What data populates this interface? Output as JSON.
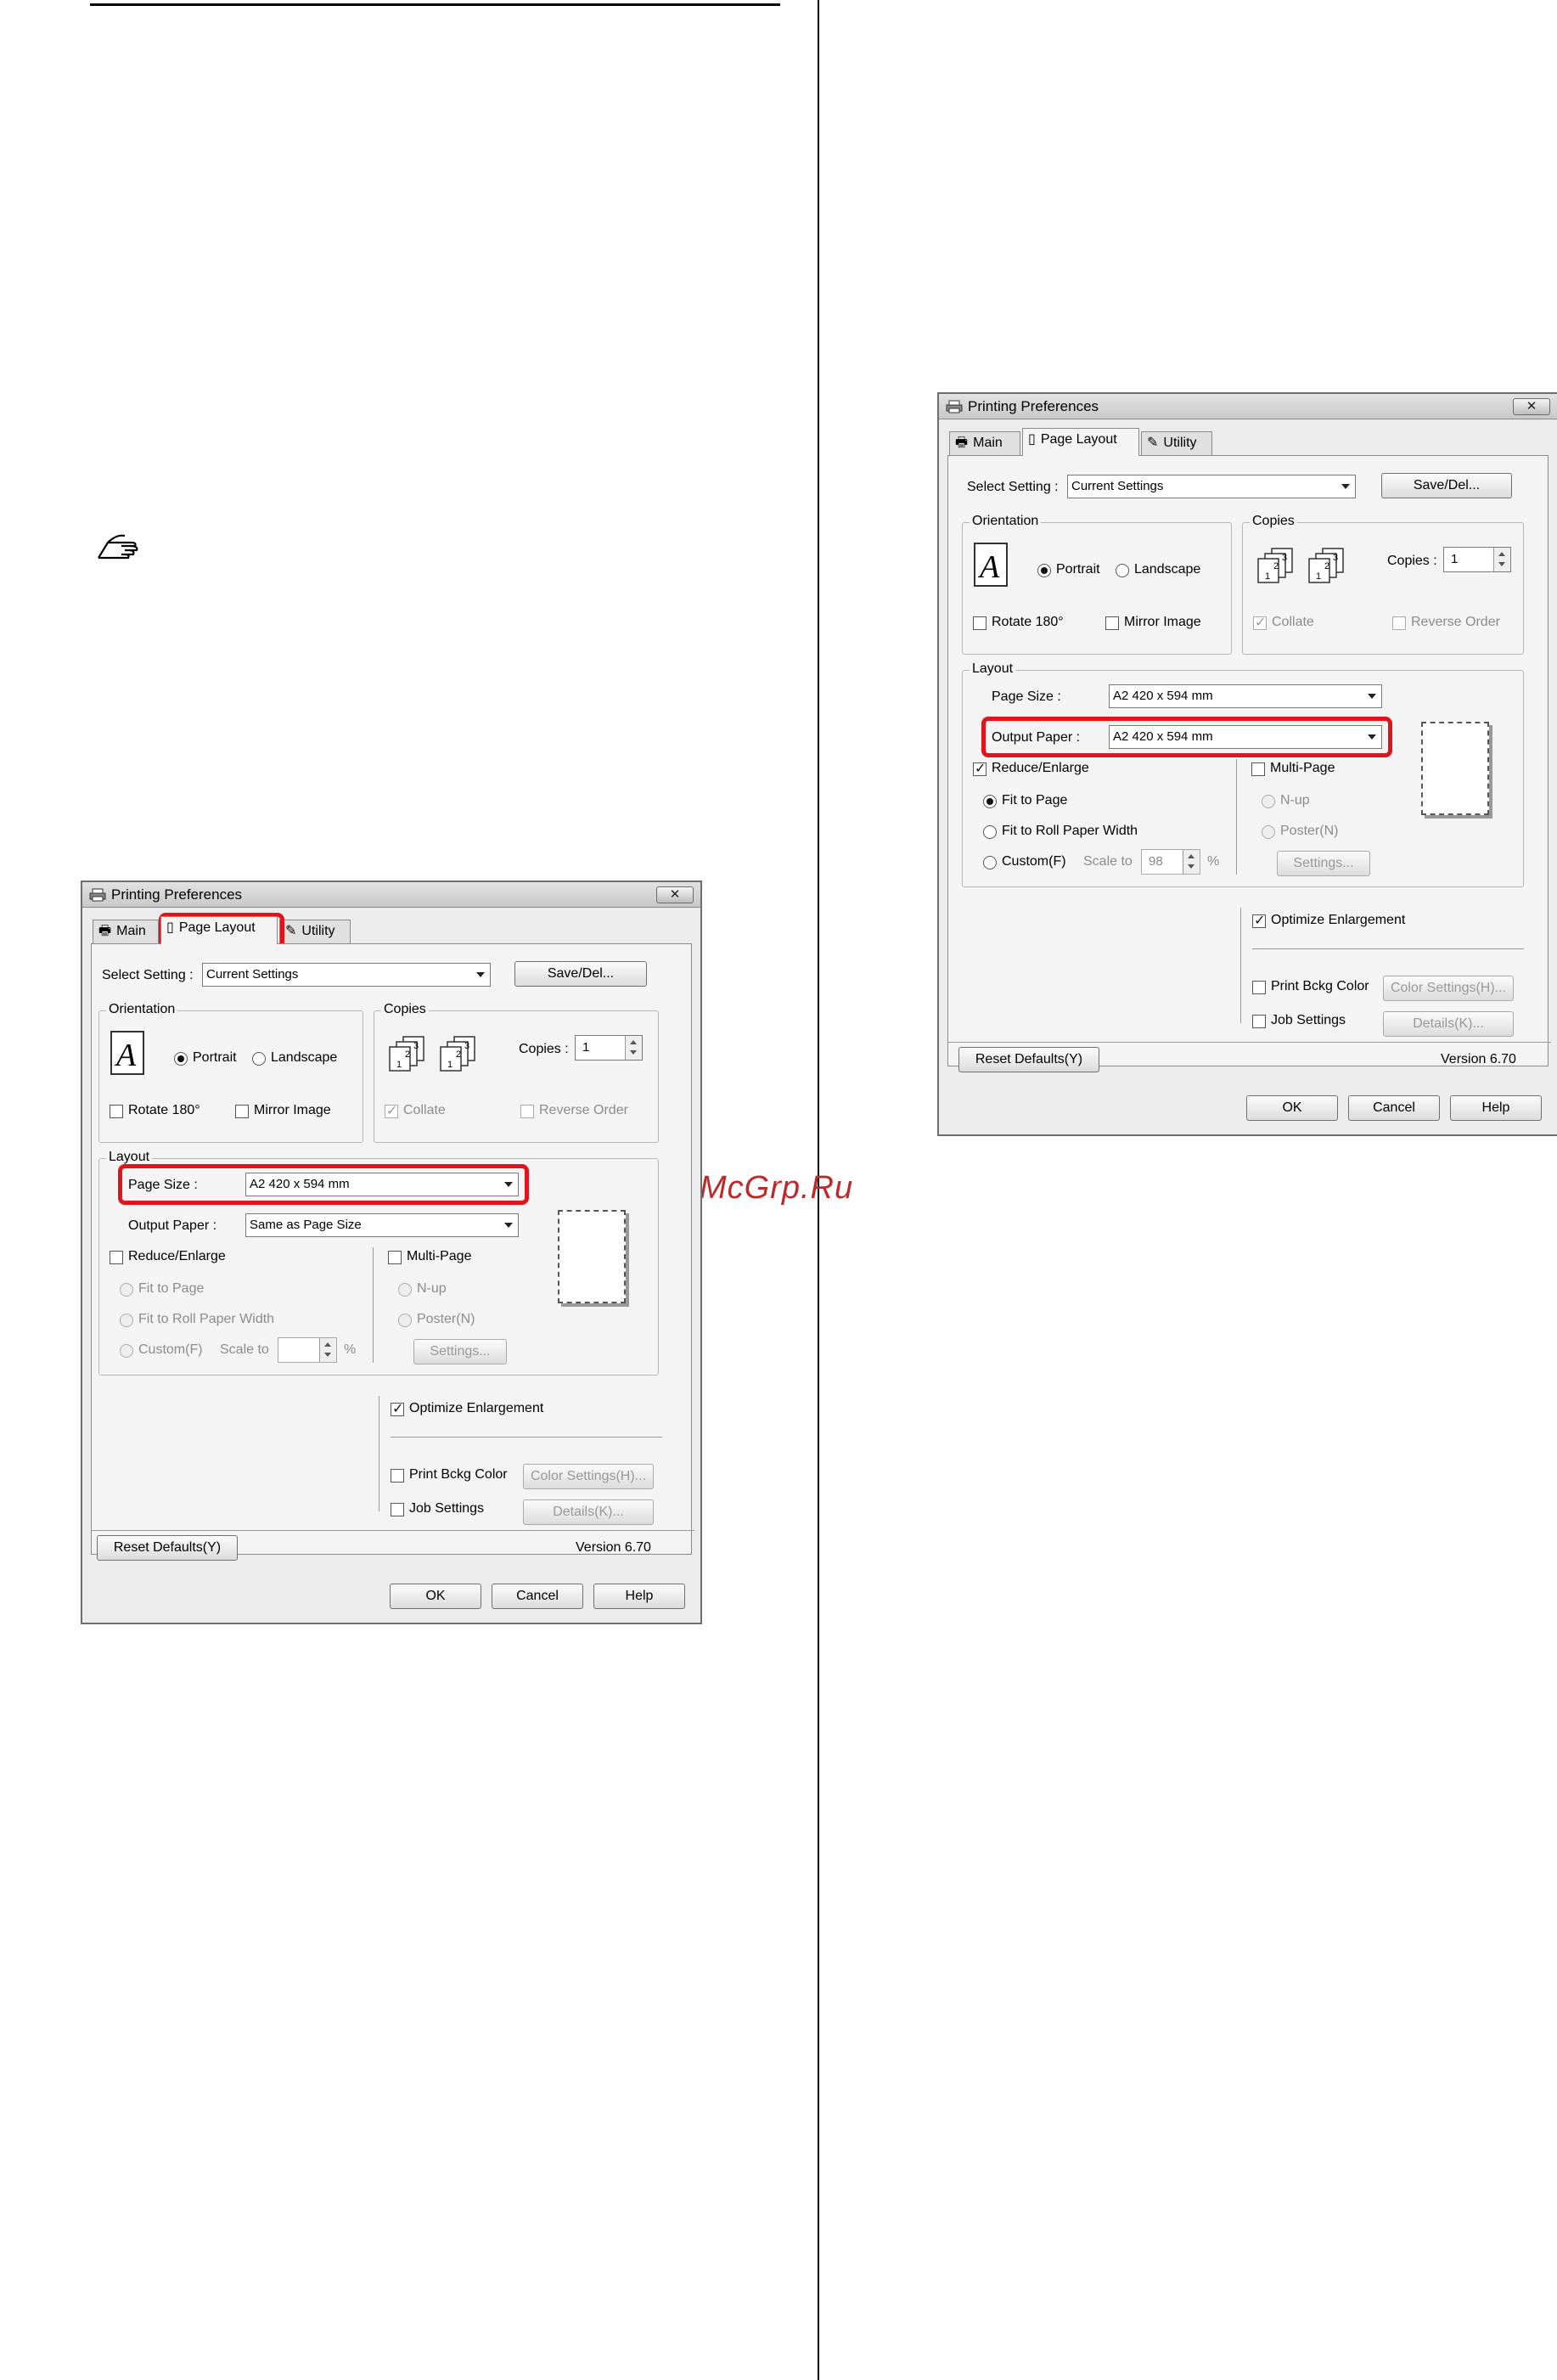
{
  "dialogs": [
    {
      "title": "Printing Preferences",
      "close": "✕",
      "tabs": [
        "Main",
        "Page Layout",
        "Utility"
      ],
      "select_setting_label": "Select Setting :",
      "select_setting_value": "Current Settings",
      "save_del": "Save/Del...",
      "orientation_title": "Orientation",
      "portrait": "Portrait",
      "landscape": "Landscape",
      "rotate": "Rotate 180°",
      "mirror": "Mirror Image",
      "copies_title": "Copies",
      "copies_label": "Copies :",
      "copies_value": "1",
      "collate": "Collate",
      "reverse": "Reverse Order",
      "layout_title": "Layout",
      "page_size_label": "Page Size :",
      "page_size_value": "A2 420 x 594 mm",
      "output_paper_label": "Output Paper :",
      "output_paper_value": "Same as Page Size",
      "reduce_enlarge": "Reduce/Enlarge",
      "fit_to_page": "Fit to Page",
      "fit_roll": "Fit to Roll Paper Width",
      "custom": "Custom(F)",
      "scale_to": "Scale to",
      "scale_value": "",
      "percent": "%",
      "multi_page": "Multi-Page",
      "n_up": "N-up",
      "poster": "Poster(N)",
      "settings": "Settings...",
      "optimize": "Optimize Enlargement",
      "print_bckg": "Print Bckg Color",
      "color_settings": "Color Settings(H)...",
      "job_settings": "Job Settings",
      "details": "Details(K)...",
      "reset": "Reset Defaults(Y)",
      "version": "Version 6.70",
      "ok": "OK",
      "cancel": "Cancel",
      "help": "Help"
    },
    {
      "title": "Printing Preferences",
      "close": "✕",
      "tabs": [
        "Main",
        "Page Layout",
        "Utility"
      ],
      "select_setting_label": "Select Setting :",
      "select_setting_value": "Current Settings",
      "save_del": "Save/Del...",
      "orientation_title": "Orientation",
      "portrait": "Portrait",
      "landscape": "Landscape",
      "rotate": "Rotate 180°",
      "mirror": "Mirror Image",
      "copies_title": "Copies",
      "copies_label": "Copies :",
      "copies_value": "1",
      "collate": "Collate",
      "reverse": "Reverse Order",
      "layout_title": "Layout",
      "page_size_label": "Page Size :",
      "page_size_value": "A2 420 x 594 mm",
      "output_paper_label": "Output Paper :",
      "output_paper_value": "A2 420 x 594 mm",
      "reduce_enlarge": "Reduce/Enlarge",
      "fit_to_page": "Fit to Page",
      "fit_roll": "Fit to Roll Paper Width",
      "custom": "Custom(F)",
      "scale_to": "Scale to",
      "scale_value": "98",
      "percent": "%",
      "multi_page": "Multi-Page",
      "n_up": "N-up",
      "poster": "Poster(N)",
      "settings": "Settings...",
      "optimize": "Optimize Enlargement",
      "print_bckg": "Print Bckg Color",
      "color_settings": "Color Settings(H)...",
      "job_settings": "Job Settings",
      "details": "Details(K)...",
      "reset": "Reset Defaults(Y)",
      "version": "Version 6.70",
      "ok": "OK",
      "cancel": "Cancel",
      "help": "Help"
    }
  ],
  "watermark": "McGrp.Ru"
}
